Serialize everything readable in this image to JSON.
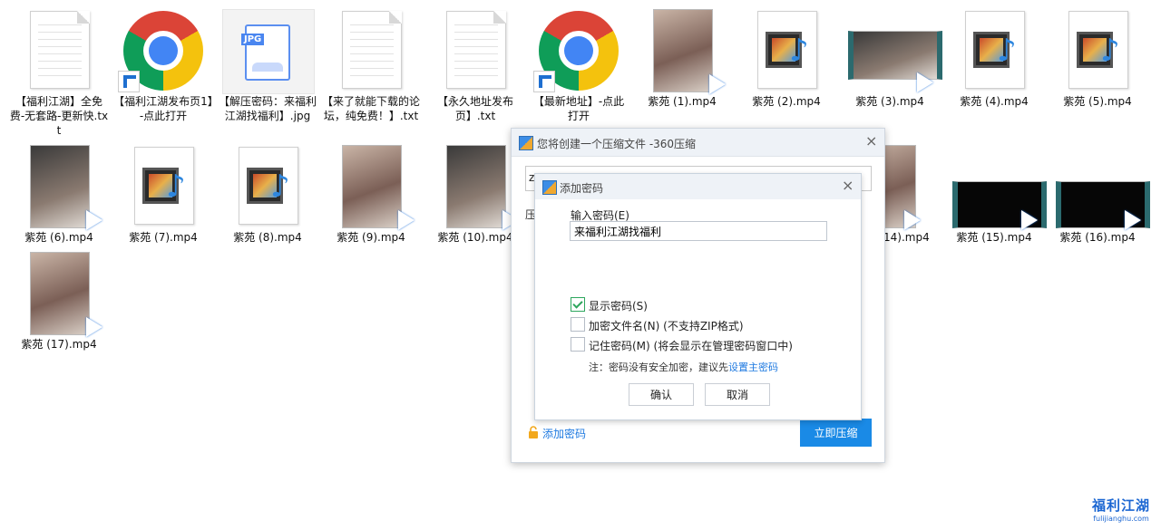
{
  "files": [
    {
      "name": "【福利江湖】全免费-无套路-更新快.txt",
      "type": "txt"
    },
    {
      "name": "【福利江湖发布页1】-点此打开",
      "type": "chrome-link"
    },
    {
      "name": "【解压密码：来福利江湖找福利】.jpg",
      "type": "jpg"
    },
    {
      "name": "【来了就能下载的论坛，纯免费！】.txt",
      "type": "txt"
    },
    {
      "name": "【永久地址发布页】.txt",
      "type": "txt"
    },
    {
      "name": "【最新地址】-点此打开",
      "type": "chrome-link"
    },
    {
      "name": "紫苑 (1).mp4",
      "type": "photo"
    },
    {
      "name": "紫苑 (2).mp4",
      "type": "video"
    },
    {
      "name": "紫苑 (3).mp4",
      "type": "photo-wide"
    },
    {
      "name": "紫苑 (4).mp4",
      "type": "video"
    },
    {
      "name": "紫苑 (5).mp4",
      "type": "video"
    },
    {
      "name": "紫苑 (6).mp4",
      "type": "photo"
    },
    {
      "name": "紫苑 (7).mp4",
      "type": "video"
    },
    {
      "name": "紫苑 (8).mp4",
      "type": "video"
    },
    {
      "name": "紫苑 (9).mp4",
      "type": "photo"
    },
    {
      "name": "紫苑 (10).mp4",
      "type": "photo"
    },
    {
      "name": "14).mp4",
      "type": "photo"
    },
    {
      "name": "紫苑 (15).mp4",
      "type": "photo-black"
    },
    {
      "name": "紫苑 (16).mp4",
      "type": "photo-black"
    },
    {
      "name": "紫苑 (17).mp4",
      "type": "photo"
    }
  ],
  "icon_jpg_tag": "JPG",
  "compress_dialog": {
    "title": "您将创建一个压缩文件 -360压缩",
    "field_value": "z",
    "label_prefix": "压",
    "add_password_link": "添加密码",
    "compress_button": "立即压缩",
    "close_icon": "×"
  },
  "password_dialog": {
    "title": "添加密码",
    "close_icon": "×",
    "input_label": "输入密码(E)",
    "password_value": "来福利江湖找福利",
    "show_password": {
      "label": "显示密码(S)",
      "checked": true
    },
    "encrypt_names": {
      "label": "加密文件名(N) (不支持ZIP格式)",
      "checked": false
    },
    "remember_password": {
      "label": "记住密码(M) (将会显示在管理密码窗口中)",
      "checked": false
    },
    "note_text": "注：密码没有安全加密，建议先",
    "note_link": "设置主密码",
    "ok_button": "确认",
    "cancel_button": "取消"
  },
  "watermark": {
    "main": "福利江湖",
    "sub": "fulijianghu.com"
  }
}
